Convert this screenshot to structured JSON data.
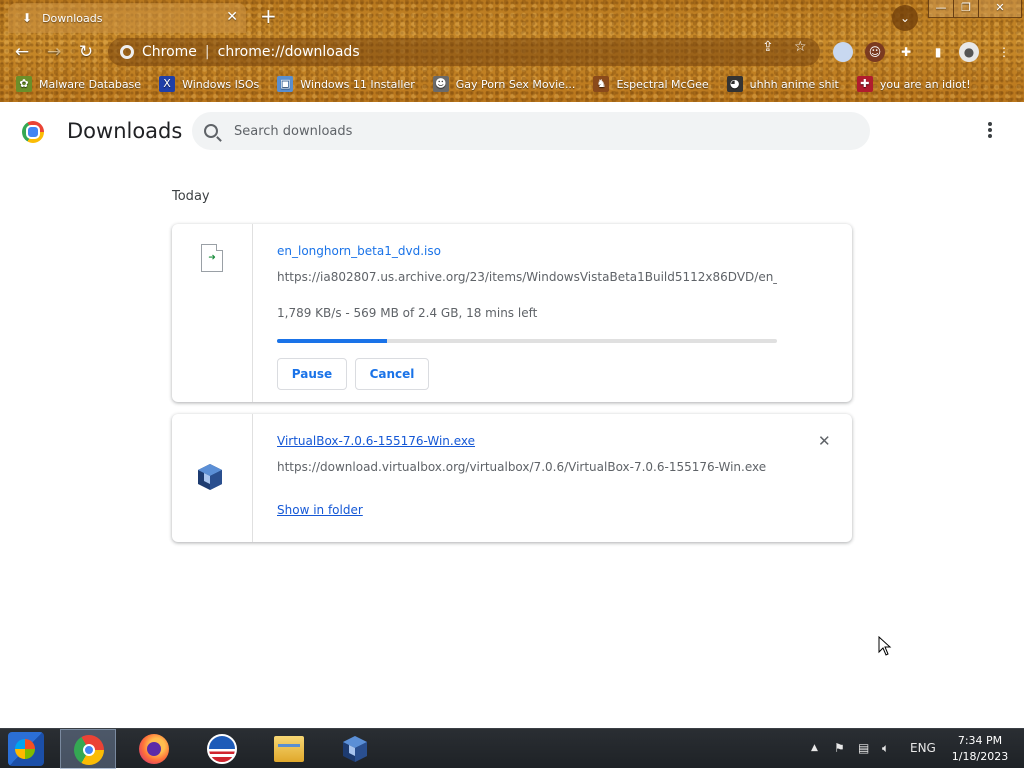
{
  "browser": {
    "tab": {
      "title": "Downloads",
      "icon": "download-icon",
      "close": "✕"
    },
    "new_tab": "+",
    "window_controls": {
      "minimize": "—",
      "restore": "❐",
      "close": "✕"
    },
    "omnibox": {
      "site_label": "Chrome",
      "url": "chrome://downloads"
    },
    "bookmarks": [
      {
        "label": "Malware Database",
        "icon": "leaf-icon",
        "color": "#6b8f2a"
      },
      {
        "label": "Windows ISOs",
        "icon": "x-icon",
        "color": "#1f3fa8"
      },
      {
        "label": "Windows 11 Installer",
        "icon": "image-icon",
        "color": "#5a8fd0"
      },
      {
        "label": "Gay Porn Sex Movie...",
        "icon": "face-icon",
        "color": "#6a6a6a"
      },
      {
        "label": "Espectral McGee",
        "icon": "character-icon",
        "color": "#8a4a1a"
      },
      {
        "label": "uhhh anime shit",
        "icon": "anime-icon",
        "color": "#333333"
      },
      {
        "label": "you are an idiot!",
        "icon": "flag-icon",
        "color": "#b01c2e"
      }
    ]
  },
  "page": {
    "title": "Downloads",
    "search": {
      "placeholder": "Search downloads",
      "value": ""
    },
    "date_group": "Today",
    "downloads": [
      {
        "filename": "en_longhorn_beta1_dvd.iso",
        "url": "https://ia802807.us.archive.org/23/items/WindowsVistaBeta1Build5112x86DVD/en_...",
        "status": "1,789 KB/s - 569 MB of 2.4 GB, 18 mins left",
        "progress": 0.22,
        "buttons": {
          "pause": "Pause",
          "cancel": "Cancel"
        }
      },
      {
        "filename": "VirtualBox-7.0.6-155176-Win.exe",
        "url": "https://download.virtualbox.org/virtualbox/7.0.6/VirtualBox-7.0.6-155176-Win.exe",
        "action": "Show in folder",
        "remove": "✕"
      }
    ]
  },
  "taskbar": {
    "pinned": [
      "chrome-icon",
      "firefox-icon",
      "obama-icon",
      "file-explorer-icon",
      "virtualbox-icon"
    ],
    "tray": {
      "chevron": "▲",
      "language": "ENG"
    },
    "clock": {
      "time": "7:34 PM",
      "date": "1/18/2023"
    }
  },
  "colors": {
    "accent": "#1a73e8",
    "theme": "#c0801f",
    "taskbar": "#22262a"
  }
}
